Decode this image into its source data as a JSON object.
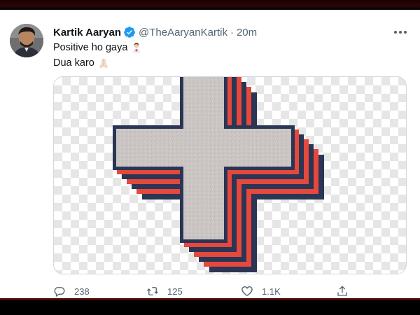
{
  "tweet": {
    "display_name": "Kartik Aaryan",
    "handle": "@TheAaryanKartik",
    "separator": "·",
    "time": "20m",
    "verified": true,
    "lines": [
      "Positive ho gaya",
      "Dua karo"
    ],
    "emojis": [
      "man-health-worker-icon",
      "folded-hands-icon"
    ],
    "media_description_icon": "plus-cross-icon",
    "colors": {
      "cross_fill": "#c9c4c2",
      "outline_navy": "#2b3554",
      "shadow_red": "#e5483c",
      "verified_blue": "#1d9bf0"
    }
  },
  "actions": {
    "reply_count": "238",
    "retweet_count": "125",
    "like_count": "1.1K"
  }
}
